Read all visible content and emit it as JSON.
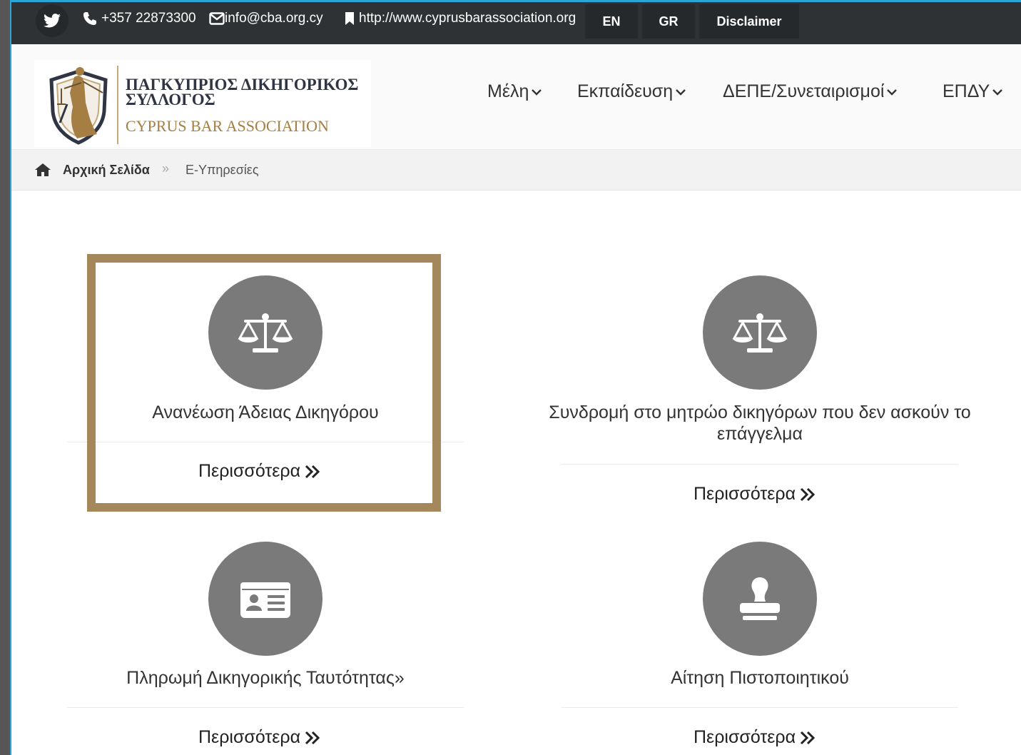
{
  "topbar": {
    "phone": "+357 22873300",
    "email": "info@cba.org.cy",
    "website": "http://www.cyprusbarassociation.org",
    "lang_en": "EN",
    "lang_gr": "GR",
    "disclaimer": "Disclaimer"
  },
  "logo": {
    "greek_line1": "ΠΑΓΚΥΠΡΙΟΣ ΔΙΚΗΓΟΡΙΚΟΣ",
    "greek_line2": "ΣΥΛΛΟΓΟΣ",
    "english": "CYPRUS BAR ASSOCIATION"
  },
  "nav": {
    "items": [
      {
        "label": "Μέλη"
      },
      {
        "label": "Εκπαίδευση"
      },
      {
        "label": "ΔΕΠΕ/Συνεταιρισμοί"
      },
      {
        "label": "ΕΠΔΥ"
      }
    ]
  },
  "breadcrumb": {
    "home": "Αρχική Σελίδα",
    "current": "Ε-Υπηρεσίες"
  },
  "services": [
    {
      "icon": "balance-scale-icon",
      "title": "Ανανέωση Άδειας Δικηγόρου",
      "more": "Περισσότερα"
    },
    {
      "icon": "balance-scale-icon",
      "title": "Συνδρομή στο μητρώο δικηγόρων που δεν ασκούν το επάγγελμα",
      "more": "Περισσότερα"
    },
    {
      "icon": "id-card-icon",
      "title": "Πληρωμή Δικηγορικής Ταυτότητας»",
      "more": "Περισσότερα"
    },
    {
      "icon": "stamp-icon",
      "title": "Αίτηση Πιστοποιητικού",
      "more": "Περισσότερα"
    }
  ],
  "colors": {
    "topbar_bg": "#2f3234",
    "accent_gold": "#a4875a",
    "icon_circle": "#7a7a7a",
    "frame_line": "#2aa6d6"
  }
}
